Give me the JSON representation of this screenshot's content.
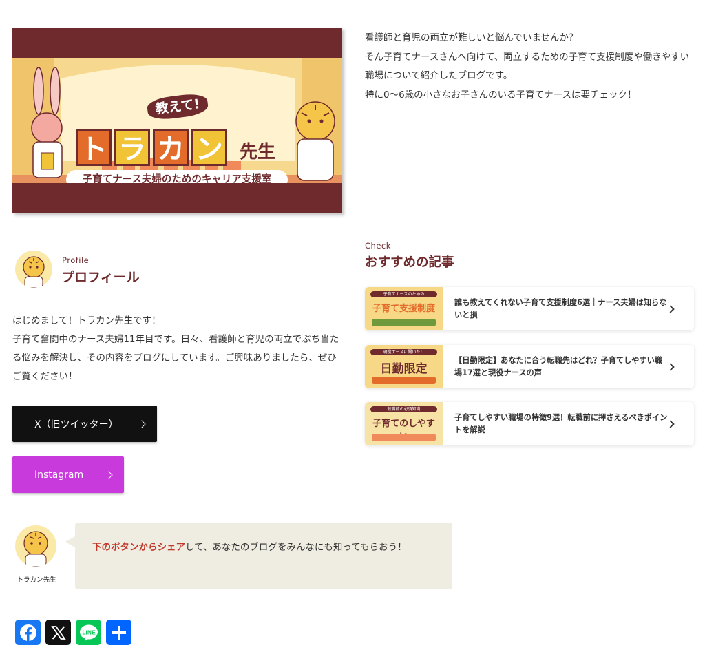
{
  "banner": {
    "badge": "教えて!",
    "big_chars": [
      "ト",
      "ラ",
      "カ",
      "ン"
    ],
    "sensei": "先生",
    "subtitle": "子育てナース夫婦のためのキャリア支援室"
  },
  "intro": {
    "lines": [
      "看護師と育児の両立が難しいと悩んでいませんか？",
      "そん子育てナースさんへ向けて、両立するための子育て支援制度や働きやすい職場について紹介したブログです。",
      "特に0〜6歳の小さなお子さんのいる子育てナースは要チェック！"
    ]
  },
  "profile": {
    "eyebrow": "Profile",
    "heading": "プロフィール",
    "greeting": "はじめまして！トラカン先生です！",
    "body": "子育て奮闘中のナース夫婦11年目です。日々、看護師と育児の両立でぶち当たる悩みを解決し、その内容をブログにしています。ご興味ありましたら、ぜひご覧ください！",
    "buttons": {
      "x_label": "X（旧ツイッター）",
      "instagram_label": "Instagram"
    },
    "colors": {
      "x": "#111111",
      "instagram": "#c93adc"
    }
  },
  "recommended": {
    "eyebrow": "Check",
    "heading": "おすすめの記事",
    "articles": [
      {
        "thumb_band": "子育てナースのための",
        "thumb_main": "子育て支援制度",
        "title": "誰も教えてくれない子育て支援制度6選｜ナース夫婦は知らないと損"
      },
      {
        "thumb_band": "現役ナースに聞いた！",
        "thumb_main": "日勤限定",
        "title": "【日勤限定】あなたに合う転職先はどれ？子育てしやすい職場17選と現役ナースの声"
      },
      {
        "thumb_band": "転職前の必須知識",
        "thumb_main": "子育てのしやすい",
        "title": "子育てしやすい職場の特徴9選！転職前に押さえるべきポイントを解説"
      }
    ]
  },
  "balloon": {
    "name": "トラカン先生",
    "highlight": "下のボタンからシェア",
    "text": "して、あなたのブログをみんなにも知ってもらおう！"
  },
  "share": {
    "icons": [
      "facebook-icon",
      "x-icon",
      "line-icon",
      "add-icon"
    ],
    "line_label": "LINE",
    "colors": {
      "facebook": "#1877f2",
      "x": "#111111",
      "line": "#06c755",
      "more": "#0166ff"
    }
  },
  "theme": {
    "accent": "#6e2a2d",
    "highlight": "#c0392b",
    "balloon_bg": "#efece1"
  }
}
